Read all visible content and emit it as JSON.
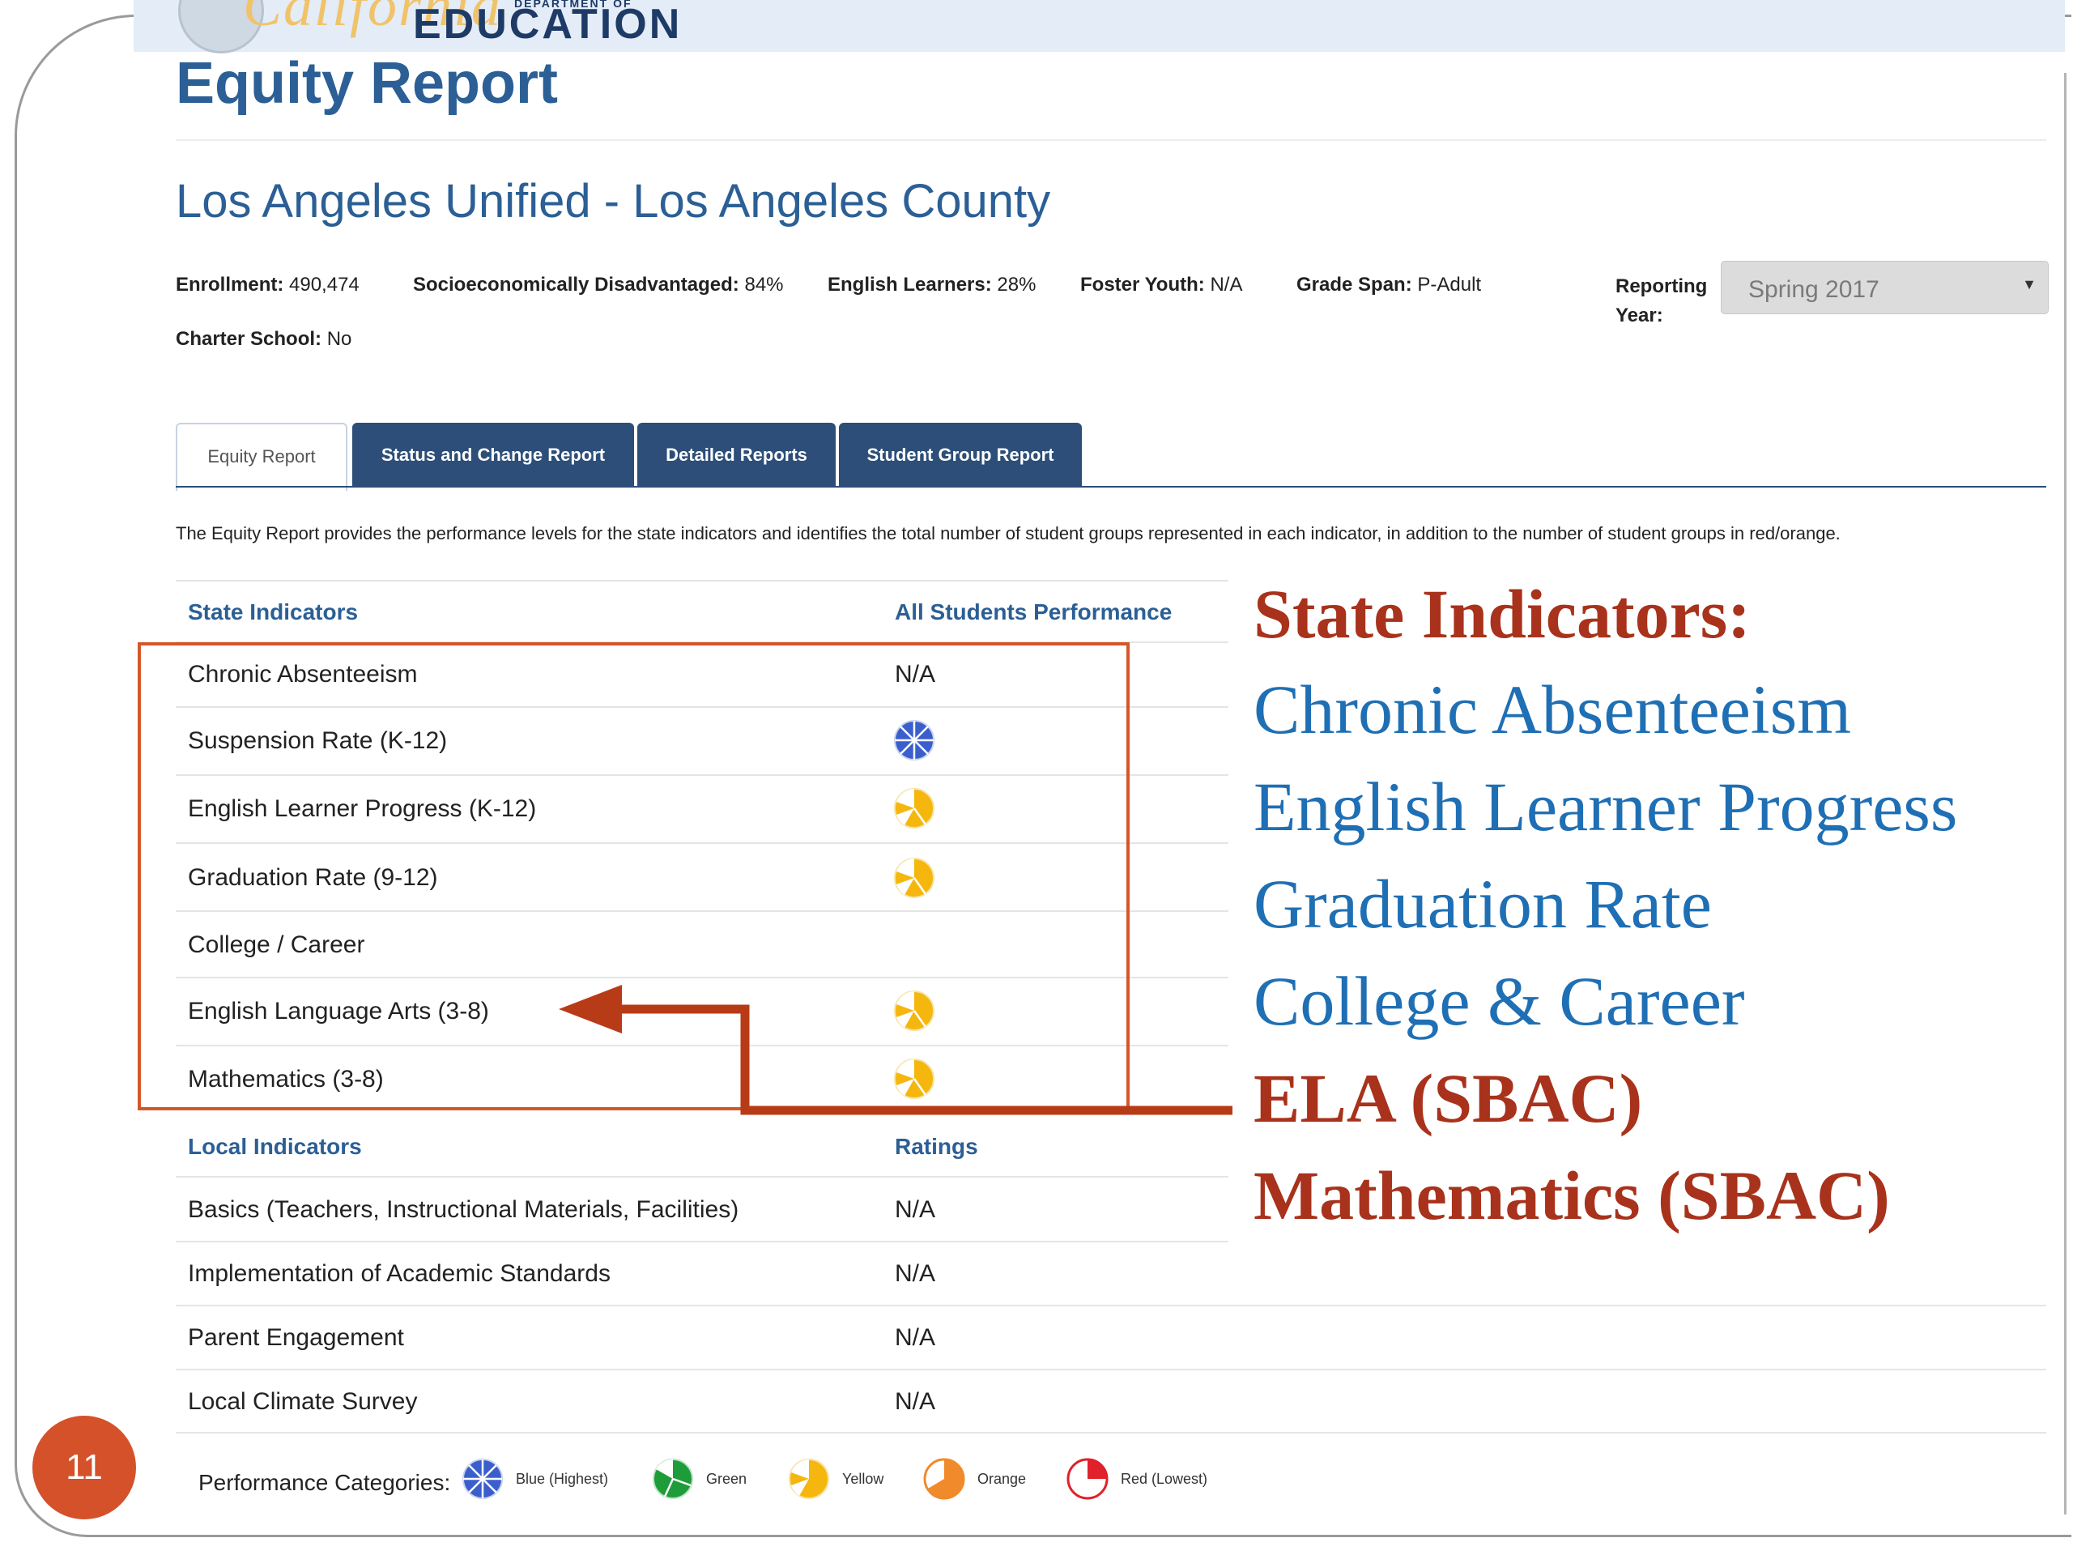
{
  "slide_number": "11",
  "banner": {
    "script": "California",
    "dept": "DEPARTMENT OF",
    "edu": "EDUCATION"
  },
  "page_title": "Equity Report",
  "district": "Los Angeles Unified - Los Angeles County",
  "meta": {
    "enrollment_label": "Enrollment:",
    "enrollment": "490,474",
    "sed_label": "Socioeconomically Disadvantaged:",
    "sed": "84%",
    "el_label": "English Learners:",
    "el": "28%",
    "fy_label": "Foster Youth:",
    "fy": "N/A",
    "gs_label": "Grade Span:",
    "gs": "P-Adult",
    "charter_label": "Charter School:",
    "charter": "No"
  },
  "reporting_year": {
    "label_line1": "Reporting",
    "label_line2": "Year:",
    "value": "Spring 2017"
  },
  "tabs": [
    {
      "label": "Equity Report",
      "active": true
    },
    {
      "label": "Status and Change Report",
      "active": false
    },
    {
      "label": "Detailed Reports",
      "active": false
    },
    {
      "label": "Student Group Report",
      "active": false
    }
  ],
  "intro": "The Equity Report provides the performance levels for the state indicators and identifies the total number of student groups represented in each indicator, in addition to the number of student groups in red/orange.",
  "state_table": {
    "col1": "State Indicators",
    "col2": "All Students Performance",
    "rows": [
      {
        "name": "Chronic Absenteeism",
        "value": "N/A",
        "level": ""
      },
      {
        "name": "Suspension Rate (K-12)",
        "value": "",
        "level": "blue"
      },
      {
        "name": "English Learner Progress (K-12)",
        "value": "",
        "level": "yellow"
      },
      {
        "name": "Graduation Rate (9-12)",
        "value": "",
        "level": "yellow"
      },
      {
        "name": "College / Career",
        "value": "",
        "level": ""
      },
      {
        "name": "English Language Arts (3-8)",
        "value": "",
        "level": "yellow"
      },
      {
        "name": "Mathematics (3-8)",
        "value": "",
        "level": "yellow"
      }
    ]
  },
  "local_table": {
    "col1": "Local Indicators",
    "col2": "Ratings",
    "rows": [
      {
        "name": "Basics (Teachers, Instructional Materials, Facilities)",
        "value": "N/A"
      },
      {
        "name": "Implementation of Academic Standards",
        "value": "N/A"
      },
      {
        "name": "Parent Engagement",
        "value": "N/A"
      },
      {
        "name": "Local Climate Survey",
        "value": "N/A"
      }
    ]
  },
  "legend": {
    "label": "Performance Categories:",
    "items": [
      {
        "text": "Blue (Highest)",
        "color": "#3a5fcd"
      },
      {
        "text": "Green",
        "color": "#1f9c3a"
      },
      {
        "text": "Yellow",
        "color": "#f5b70e"
      },
      {
        "text": "Orange",
        "color": "#f08a2a"
      },
      {
        "text": "Red (Lowest)",
        "color": "#e0202a"
      }
    ]
  },
  "callouts": [
    {
      "text": "State Indicators:",
      "style": "red"
    },
    {
      "text": "Chronic Absenteeism",
      "style": "blue"
    },
    {
      "text": "English Learner Progress",
      "style": "blue"
    },
    {
      "text": "Graduation Rate",
      "style": "blue"
    },
    {
      "text": "College & Career",
      "style": "blue"
    },
    {
      "text": "ELA (SBAC)",
      "style": "red"
    },
    {
      "text": "Mathematics (SBAC)",
      "style": "red"
    }
  ],
  "colors": {
    "accent_blue": "#2b5f95",
    "tab_navy": "#2c4e78",
    "highlight_orange": "#d4572a",
    "callout_red": "#a8321b",
    "callout_blue": "#1f6fb4"
  }
}
